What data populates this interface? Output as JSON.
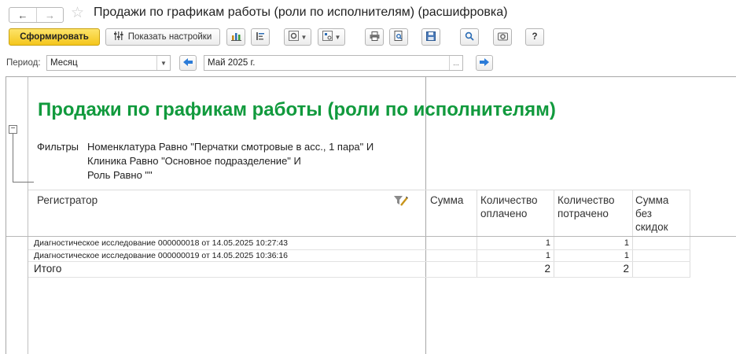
{
  "window": {
    "title": "Продажи по графикам работы (роли по исполнителям) (расшифровка)"
  },
  "toolbar": {
    "generate_label": "Сформировать",
    "settings_label": "Показать настройки",
    "help_label": "?"
  },
  "period": {
    "label": "Период:",
    "type_value": "Месяц",
    "date_value": "Май 2025 г.",
    "ellipsis": "..."
  },
  "report": {
    "title": "Продажи по графикам работы (роли по исполнителям)",
    "filters_label": "Фильтры",
    "filter_lines": [
      "Номенклатура Равно \"Перчатки смотровые в асс., 1 пара\" И",
      "Клиника Равно \"Основное подразделение\" И",
      "Роль Равно \"\""
    ],
    "columns": {
      "registrator": "Регистратор",
      "sum": "Сумма",
      "qty_paid": [
        "Количество",
        "оплачено"
      ],
      "qty_spent": [
        "Количество",
        "потрачено"
      ],
      "sum_no_disc": [
        "Сумма",
        "без",
        "скидок"
      ]
    },
    "rows": [
      {
        "registrator": "Диагностическое исследование 000000018 от 14.05.2025 10:27:43",
        "sum": "",
        "qty_paid": "1",
        "qty_spent": "1",
        "sum_no_disc": ""
      },
      {
        "registrator": "Диагностическое исследование 000000019 от 14.05.2025 10:36:16",
        "sum": "",
        "qty_paid": "1",
        "qty_spent": "1",
        "sum_no_disc": ""
      }
    ],
    "total": {
      "label": "Итого",
      "qty_paid": "2",
      "qty_spent": "2"
    }
  },
  "colors": {
    "title_green": "#119a3d",
    "primary_button": "#f4c61c",
    "nav_arrow_blue": "#2b7bd8"
  }
}
